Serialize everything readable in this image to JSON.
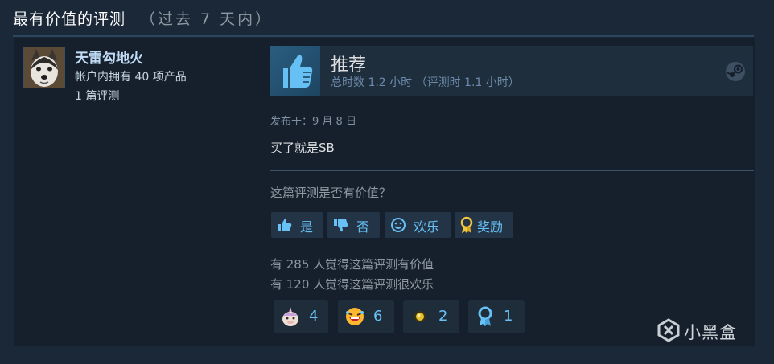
{
  "section": {
    "title": "最有价值的评测",
    "subtitle": "（过去 7 天内）"
  },
  "author": {
    "name": "天雷勾地火",
    "products": "帐户内拥有 40 项产品",
    "reviews": "1 篇评测",
    "avatar_icon": "husky-avatar"
  },
  "review": {
    "verdict": "推荐",
    "hours": "总时数 1.2 小时 （评测时 1.1 小时）",
    "posted": "发布于：9 月 8 日",
    "text": "买了就是SB",
    "verdict_icon": "thumbs-up-icon",
    "platform_icon": "steam-icon"
  },
  "helpful": {
    "question": "这篇评测是否有价值？",
    "buttons": {
      "yes": "是",
      "no": "否",
      "funny": "欢乐",
      "award": "奖励"
    },
    "stat_helpful": "有 285 人觉得这篇评测有价值",
    "stat_funny": "有 120 人觉得这篇评测很欢乐"
  },
  "awards": [
    {
      "icon": "unicorn-face-icon",
      "count": "4"
    },
    {
      "icon": "laughing-face-icon",
      "count": "6"
    },
    {
      "icon": "golden-orb-icon",
      "count": "2"
    },
    {
      "icon": "ribbon-medal-icon",
      "count": "1"
    }
  ],
  "watermark": {
    "text": "小黑盒",
    "icon": "xiaoheihe-logo-icon"
  },
  "colors": {
    "background": "#1b2838",
    "card": "#16202d",
    "accent": "#67c1f5",
    "author_name": "#c1dbf4"
  }
}
